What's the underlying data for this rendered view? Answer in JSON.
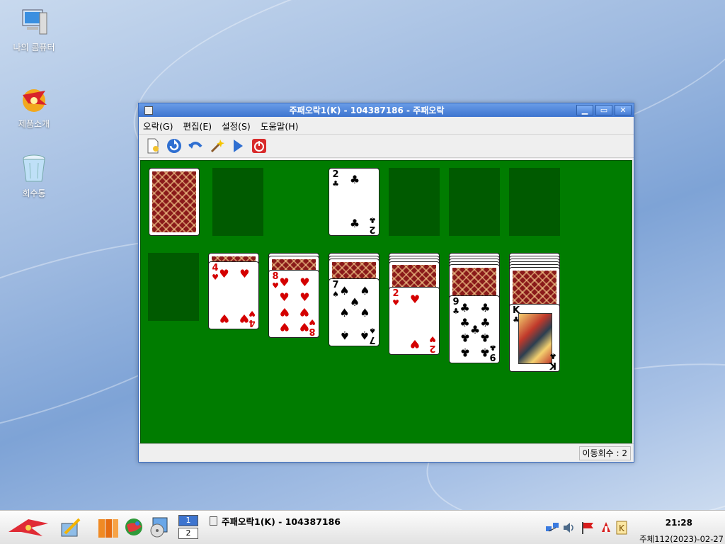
{
  "desktop": {
    "icons": [
      {
        "label": "나의 콤퓨터",
        "icon": "computer-icon"
      },
      {
        "label": "제품소개",
        "icon": "product-intro-icon"
      },
      {
        "label": "회수통",
        "icon": "recycle-bin-icon"
      }
    ]
  },
  "window": {
    "title": "주패오락1(K) - 104387186 - 주패오락",
    "menu": [
      "오락(G)",
      "편집(E)",
      "설정(S)",
      "도움말(H)"
    ],
    "toolbar": [
      "new-game-icon",
      "restart-icon",
      "undo-icon",
      "hint-wand-icon",
      "play-icon",
      "quit-icon"
    ],
    "status": "이동회수 : 2"
  },
  "game": {
    "foundation": [
      {
        "rank": "2",
        "suit": "♣"
      }
    ],
    "tableau": [
      {
        "hidden": 0,
        "top": null
      },
      {
        "hidden": 1,
        "top": {
          "rank": "4",
          "suit": "♥"
        }
      },
      {
        "hidden": 2,
        "top": {
          "rank": "8",
          "suit": "♥"
        }
      },
      {
        "hidden": 3,
        "top": {
          "rank": "7",
          "suit": "♠"
        }
      },
      {
        "hidden": 4,
        "top": {
          "rank": "2",
          "suit": "♥"
        }
      },
      {
        "hidden": 5,
        "top": {
          "rank": "9",
          "suit": "♣"
        }
      },
      {
        "hidden": 6,
        "top": {
          "rank": "K",
          "suit": "♣"
        }
      }
    ]
  },
  "taskbar": {
    "pager": [
      "1",
      "2"
    ],
    "task_title": "주패오락1(K) - 104387186",
    "clock": "21:28",
    "date": "주체112(2023)-02-27"
  },
  "colors": {
    "felt": "#007c00",
    "titlebar": "#3d74cf"
  }
}
